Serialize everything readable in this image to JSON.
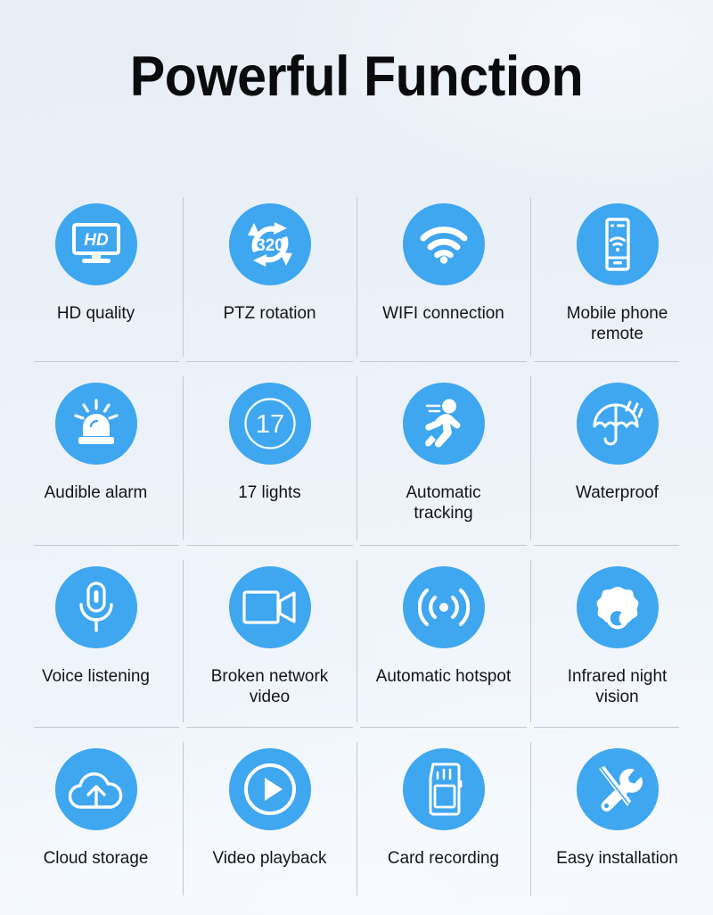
{
  "page": {
    "title": "Powerful Function",
    "background_color": "#e9eef7",
    "accent_color": "#3fa6f0",
    "label_color": "#141418",
    "divider_color": "#c2c7d0"
  },
  "features": [
    {
      "icon": "hd-monitor-icon",
      "label": "HD quality",
      "badge_text": "HD"
    },
    {
      "icon": "ptz-rotation-icon",
      "label": "PTZ rotation",
      "badge_text": "320"
    },
    {
      "icon": "wifi-icon",
      "label": "WIFI connection",
      "badge_text": ""
    },
    {
      "icon": "mobile-phone-wifi-icon",
      "label": "Mobile phone\nremote",
      "badge_text": ""
    },
    {
      "icon": "siren-alarm-icon",
      "label": "Audible alarm",
      "badge_text": ""
    },
    {
      "icon": "lights-count-icon",
      "label": "17 lights",
      "badge_text": "17"
    },
    {
      "icon": "running-person-icon",
      "label": "Automatic\ntracking",
      "badge_text": ""
    },
    {
      "icon": "umbrella-rain-icon",
      "label": "Waterproof",
      "badge_text": ""
    },
    {
      "icon": "microphone-icon",
      "label": "Voice listening",
      "badge_text": ""
    },
    {
      "icon": "video-camera-icon",
      "label": "Broken network\nvideo",
      "badge_text": ""
    },
    {
      "icon": "hotspot-signal-icon",
      "label": "Automatic hotspot",
      "badge_text": ""
    },
    {
      "icon": "night-vision-dome-icon",
      "label": "Infrared night\nvision",
      "badge_text": ""
    },
    {
      "icon": "cloud-upload-icon",
      "label": "Cloud storage",
      "badge_text": ""
    },
    {
      "icon": "play-circle-icon",
      "label": "Video playback",
      "badge_text": ""
    },
    {
      "icon": "sd-card-icon",
      "label": "Card recording",
      "badge_text": ""
    },
    {
      "icon": "wrench-screwdriver-icon",
      "label": "Easy installation",
      "badge_text": ""
    }
  ]
}
